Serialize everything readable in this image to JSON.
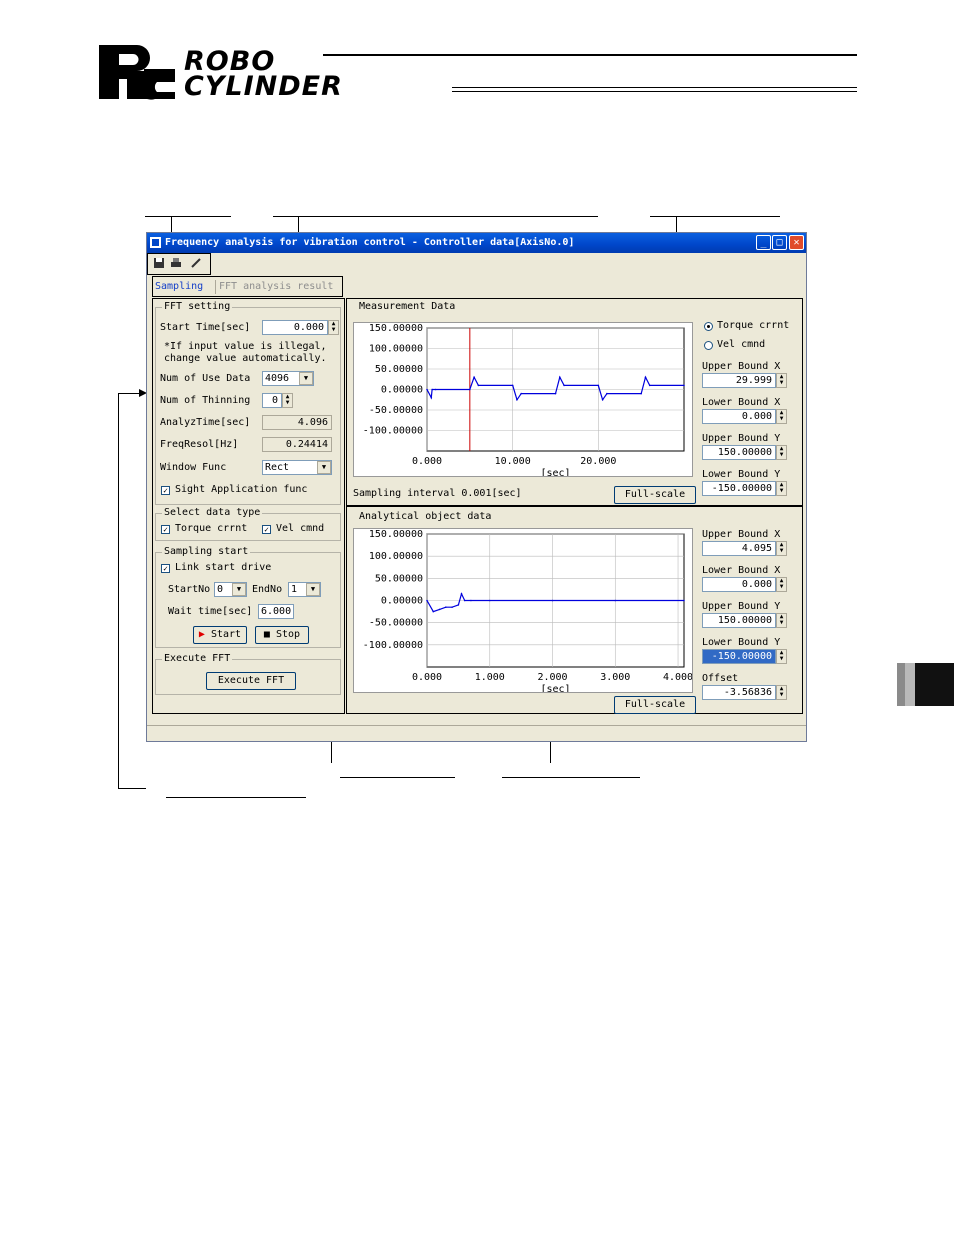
{
  "header": {
    "logo_line1": "ROBO",
    "logo_line2": "CYLINDER"
  },
  "window": {
    "title": "Frequency analysis for vibration control - Controller data[AxisNo.0]",
    "minimize": "_",
    "maximize": "□",
    "close": "✕"
  },
  "toolbar": {
    "icons": [
      "save-icon",
      "print-icon",
      "pen-icon"
    ]
  },
  "tabs": {
    "sampling": "Sampling",
    "fft_result": "FFT analysis result"
  },
  "fft_setting": {
    "group_label": "FFT setting",
    "start_time_label": "Start Time[sec]",
    "start_time_value": "0.000",
    "note_line1": "*If input value is illegal,",
    "note_line2": "change value automatically.",
    "num_use_data_label": "Num of Use Data",
    "num_use_data_value": "4096",
    "num_thinning_label": "Num of Thinning",
    "num_thinning_value": "0",
    "analyz_time_label": "AnalyzTime[sec]",
    "analyz_time_value": "4.096",
    "freq_resol_label": "FreqResol[Hz]",
    "freq_resol_value": "0.24414",
    "window_func_label": "Window Func",
    "window_func_value": "Rect",
    "sight_label": "Sight Application func"
  },
  "select_data_type": {
    "group_label": "Select data type",
    "torque_label": "Torque crrnt",
    "vel_label": "Vel cmnd"
  },
  "sampling_start": {
    "group_label": "Sampling start",
    "link_label": "Link start drive",
    "startno_label": "StartNo",
    "startno_value": "0",
    "endno_label": "EndNo",
    "endno_value": "1",
    "wait_label": "Wait time[sec]",
    "wait_value": "6.000",
    "start_btn": "Start",
    "stop_btn": "Stop"
  },
  "execute_fft": {
    "group_label": "Execute FFT",
    "button": "Execute FFT"
  },
  "measurement": {
    "group_label": "Measurement Data",
    "radio_torque": "Torque crrnt",
    "radio_vel": "Vel cmnd",
    "upper_x_label": "Upper Bound X",
    "upper_x_value": "29.999",
    "lower_x_label": "Lower Bound X",
    "lower_x_value": "0.000",
    "upper_y_label": "Upper Bound Y",
    "upper_y_value": "150.00000",
    "lower_y_label": "Lower Bound Y",
    "lower_y_value": "-150.00000",
    "sampling_interval": "Sampling interval 0.001[sec]",
    "fullscale": "Full-scale",
    "y_ticks": [
      "150.00000",
      "100.00000",
      "50.00000",
      "0.00000",
      "-50.00000",
      "-100.00000"
    ],
    "x_ticks": [
      "0.000",
      "10.000",
      "20.000"
    ],
    "x_unit": "[sec]"
  },
  "analytical": {
    "group_label": "Analytical object data",
    "upper_x_label": "Upper Bound X",
    "upper_x_value": "4.095",
    "lower_x_label": "Lower Bound X",
    "lower_x_value": "0.000",
    "upper_y_label": "Upper Bound Y",
    "upper_y_value": "150.00000",
    "lower_y_label": "Lower Bound Y",
    "lower_y_value": "-150.00000",
    "offset_label": "Offset",
    "offset_value": "-3.56836",
    "fullscale": "Full-scale",
    "y_ticks": [
      "150.00000",
      "100.00000",
      "50.00000",
      "0.00000",
      "-50.00000",
      "-100.00000"
    ],
    "x_ticks": [
      "0.000",
      "1.000",
      "2.000",
      "3.000",
      "4.000"
    ],
    "x_unit": "[sec]"
  },
  "chart_data": [
    {
      "type": "line",
      "name": "measurement",
      "xlim": [
        0,
        29.999
      ],
      "ylim": [
        -150,
        150
      ],
      "x": [
        0,
        0.5,
        0.6,
        1.0,
        5.0,
        5.5,
        6.0,
        10.0,
        10.5,
        11.0,
        15.0,
        15.5,
        16.0,
        20.0,
        20.5,
        21.0,
        25.0,
        25.5,
        26.0,
        30.0
      ],
      "y": [
        0,
        -20,
        0,
        0,
        0,
        30,
        10,
        10,
        -25,
        -10,
        -10,
        30,
        10,
        10,
        -25,
        -10,
        -10,
        30,
        10,
        10
      ]
    },
    {
      "type": "line",
      "name": "analytical",
      "xlim": [
        0,
        4.095
      ],
      "ylim": [
        -150,
        150
      ],
      "x": [
        0,
        0.1,
        0.2,
        0.3,
        0.4,
        0.5,
        0.55,
        0.6,
        0.7,
        1.0,
        2.0,
        3.0,
        4.095
      ],
      "y": [
        0,
        -25,
        -20,
        -15,
        -15,
        -10,
        15,
        0,
        0,
        0,
        0,
        0,
        0
      ]
    }
  ]
}
